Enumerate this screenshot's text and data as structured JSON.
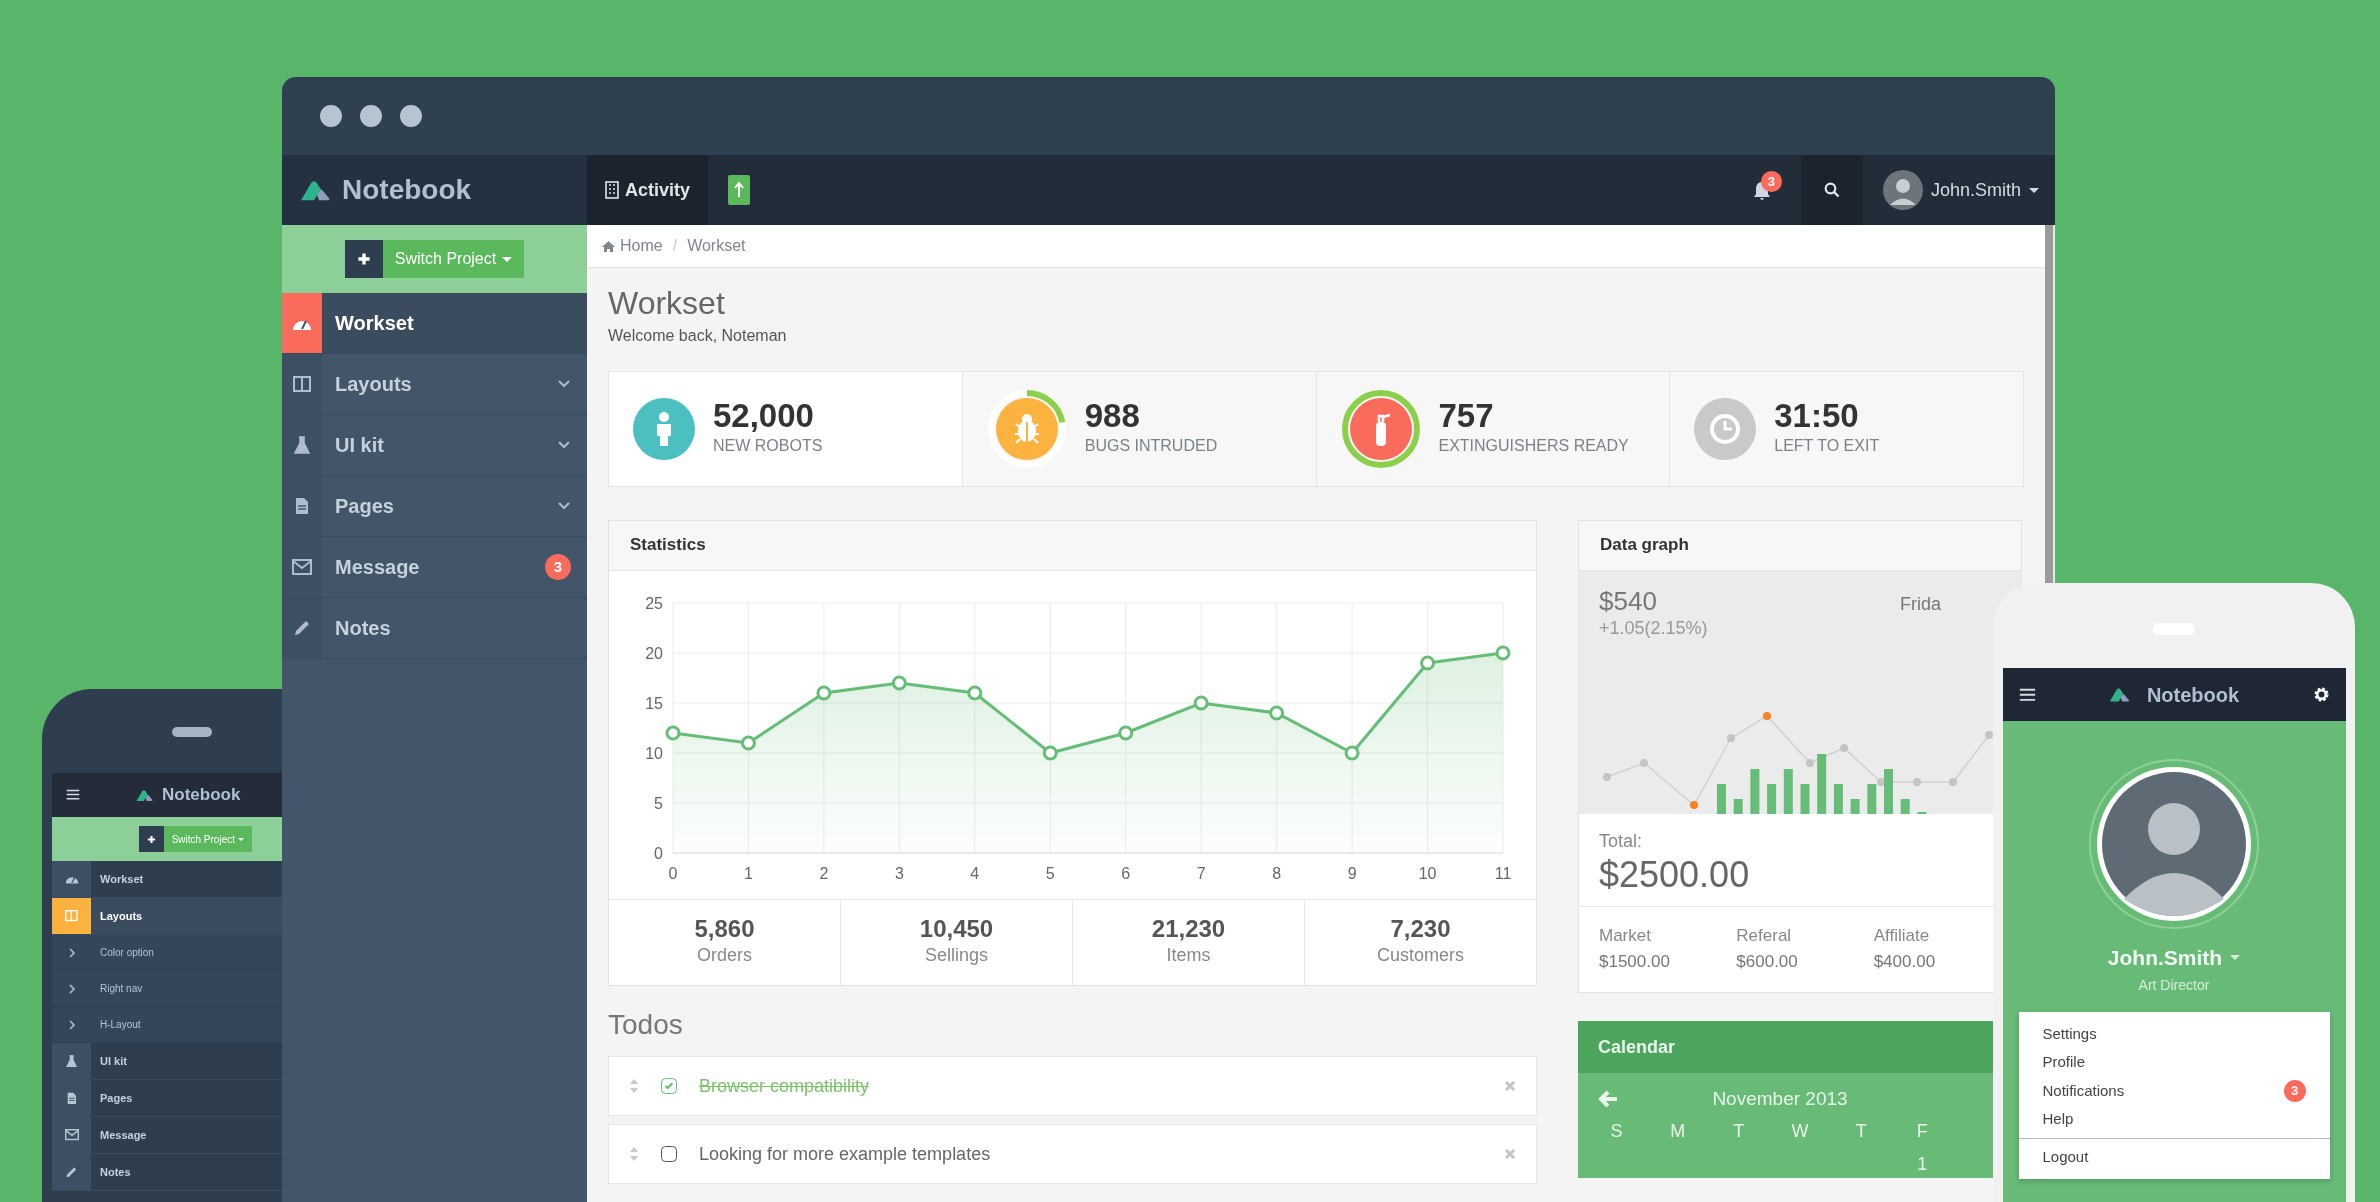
{
  "brand": "Notebook",
  "topbar": {
    "tabs": [
      {
        "label": "Activity",
        "selected": true
      }
    ],
    "notification_count": "3",
    "user": "John.Smith"
  },
  "switch_project": "Switch Project",
  "sidebar": {
    "items": [
      {
        "label": "Workset",
        "selected": true,
        "color": "#fb6b5b"
      },
      {
        "label": "Layouts",
        "selected": false,
        "expanded": false
      },
      {
        "label": "UI kit",
        "selected": false,
        "expanded": false
      },
      {
        "label": "Pages",
        "selected": false,
        "expanded": false
      },
      {
        "label": "Message",
        "selected": false,
        "badge": "3"
      },
      {
        "label": "Notes",
        "selected": false
      }
    ]
  },
  "breadcrumb": {
    "separator": "/",
    "items": [
      "Home",
      "Workset"
    ]
  },
  "page": {
    "title": "Workset",
    "subtitle": "Welcome back, Noteman"
  },
  "stats": [
    {
      "value": "52,000",
      "label": "NEW ROBOTS",
      "color": "#4cc0c1"
    },
    {
      "value": "988",
      "label": "BUGS INTRUDED",
      "color": "#fbb23e",
      "level": 0.22
    },
    {
      "value": "757",
      "label": "EXTINGUISHERS READY",
      "color": "#fb6b5b",
      "level": 1
    },
    {
      "value": "31:50",
      "label": "LEFT TO EXIT",
      "color": "#c9c9c9"
    }
  ],
  "statistics": {
    "title": "Statistics",
    "chart_data": {
      "type": "area",
      "x": [
        0,
        1,
        2,
        3,
        4,
        5,
        6,
        7,
        8,
        9,
        10,
        11
      ],
      "series": [
        {
          "color": "#65bd77",
          "values": [
            12,
            11,
            16,
            17,
            16,
            10,
            12,
            15,
            14,
            10,
            19,
            20
          ]
        }
      ],
      "xlim": [
        0,
        11
      ],
      "ylim": [
        0,
        25
      ],
      "grid": true,
      "xticks": [
        0,
        1,
        2,
        3,
        4,
        5,
        6,
        7,
        8,
        9,
        10,
        11
      ],
      "yticks": [
        0,
        5,
        10,
        15,
        20,
        25
      ]
    },
    "totals": [
      {
        "value": "5,860",
        "label": "Orders"
      },
      {
        "value": "10,450",
        "label": "Sellings"
      },
      {
        "value": "21,230",
        "label": "Items"
      },
      {
        "value": "7,230",
        "label": "Customers"
      }
    ]
  },
  "todos": {
    "title": "Todos",
    "items": [
      {
        "text": "Browser compatibility",
        "checked": true
      },
      {
        "text": "Looking for more example templates",
        "checked": false
      }
    ]
  },
  "data_graph": {
    "title": "Data graph",
    "price": "$540",
    "change": "+1.05(2.15%)",
    "day": "Frida",
    "total_label": "Total:",
    "total": "$2500.00",
    "breakdown": [
      {
        "label": "Market",
        "value": "$1500.00"
      },
      {
        "label": "Referal",
        "value": "$600.00"
      },
      {
        "label": "Affiliate",
        "value": "$400.00"
      }
    ]
  },
  "calendar": {
    "title": "Calendar",
    "month": "November 2013",
    "weekdays": [
      {
        "label": "S"
      },
      {
        "label": "M"
      },
      {
        "label": "T"
      },
      {
        "label": "W"
      },
      {
        "label": "T"
      },
      {
        "label": "F",
        "dates": [
          "1"
        ]
      }
    ]
  },
  "mobile_left": {
    "brand": "Notebook",
    "switch_project": "Switch Project",
    "items": [
      {
        "label": "Workset",
        "selected": false
      },
      {
        "label": "Layouts",
        "selected": true,
        "color": "#fbb23e",
        "children": [
          {
            "label": "Color option"
          },
          {
            "label": "Right nav"
          },
          {
            "label": "H-Layout"
          }
        ]
      },
      {
        "label": "UI kit",
        "selected": false
      },
      {
        "label": "Pages",
        "selected": false
      },
      {
        "label": "Message",
        "selected": false
      },
      {
        "label": "Notes",
        "selected": false
      }
    ]
  },
  "mobile_right": {
    "brand": "Notebook",
    "user": "John.Smith",
    "role": "Art Director",
    "menu": [
      {
        "label": "Settings"
      },
      {
        "label": "Profile"
      },
      {
        "label": "Notifications",
        "badge": "3"
      },
      {
        "label": "Help"
      },
      {
        "label": "Logout",
        "divider_before": true
      }
    ]
  }
}
